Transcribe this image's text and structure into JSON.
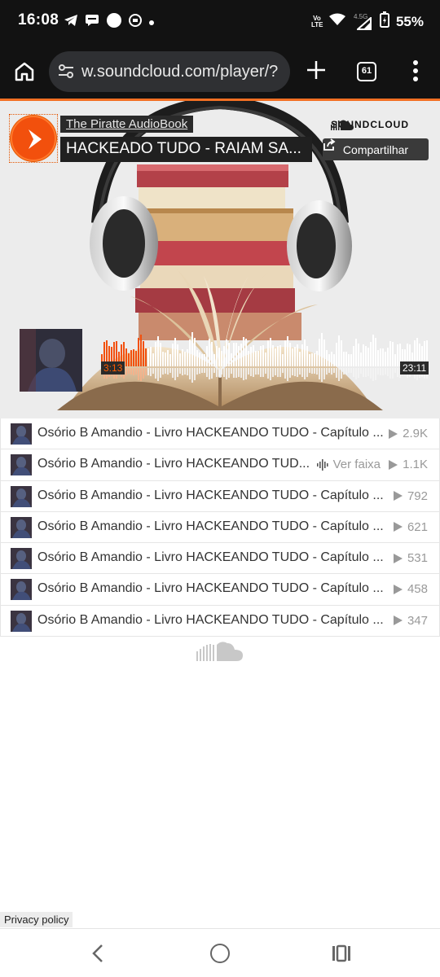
{
  "status_bar": {
    "time": "16:08",
    "network_label": "4.5G",
    "volte_label": "Vo LTE",
    "battery": "55%"
  },
  "browser": {
    "url": "w.soundcloud.com/player/?",
    "tab_count": "61"
  },
  "player": {
    "artist": "The Piratte AudioBook",
    "title": "HACKEADO TUDO - RAIAM SA...",
    "brand": "SOUNDCLOUD",
    "share_label": "Compartilhar",
    "current_time": "3:13",
    "duration": "23:11",
    "progress": 0.139,
    "accent_color": "#f2500d"
  },
  "tracks": [
    {
      "title": "Osório B Amandio - Livro HACKEANDO TUDO - Capítulo ...",
      "plays": "2.9K"
    },
    {
      "title": "Osório B Amandio - Livro HACKEANDO TUD...",
      "plays": "1.1K",
      "hover_label": "Ver faixa"
    },
    {
      "title": "Osório B Amandio - Livro HACKEANDO TUDO - Capítulo ...",
      "plays": "792"
    },
    {
      "title": "Osório B Amandio - Livro HACKEANDO TUDO - Capítulo ...",
      "plays": "621"
    },
    {
      "title": "Osório B Amandio - Livro HACKEANDO TUDO - Capítulo ...",
      "plays": "531"
    },
    {
      "title": "Osório B Amandio - Livro HACKEANDO TUDO - Capítulo ...",
      "plays": "458"
    },
    {
      "title": "Osório B Amandio - Livro HACKEANDO TUDO - Capítulo ...",
      "plays": "347"
    }
  ],
  "footer": {
    "privacy_label": "Privacy policy"
  }
}
